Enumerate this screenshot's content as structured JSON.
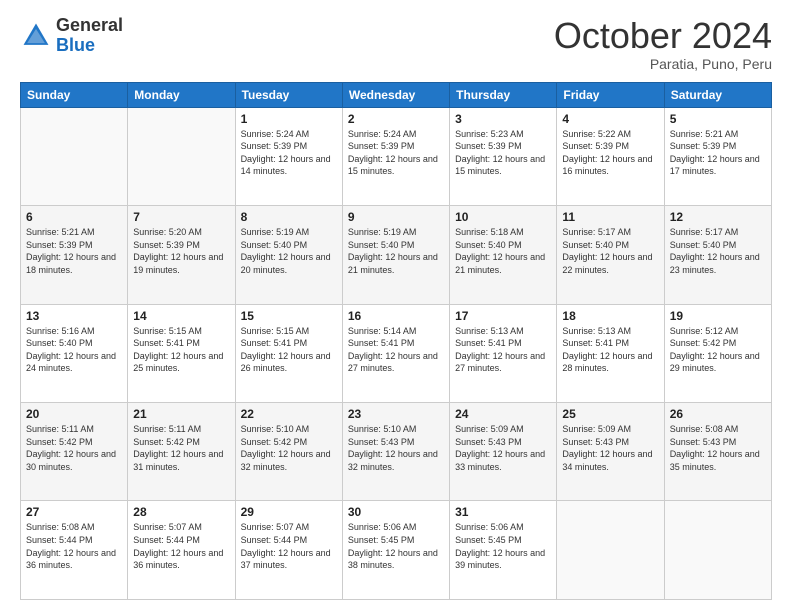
{
  "header": {
    "logo_general": "General",
    "logo_blue": "Blue",
    "month": "October 2024",
    "location": "Paratia, Puno, Peru"
  },
  "days_of_week": [
    "Sunday",
    "Monday",
    "Tuesday",
    "Wednesday",
    "Thursday",
    "Friday",
    "Saturday"
  ],
  "weeks": [
    {
      "days": [
        {
          "num": "",
          "info": ""
        },
        {
          "num": "",
          "info": ""
        },
        {
          "num": "1",
          "info": "Sunrise: 5:24 AM\nSunset: 5:39 PM\nDaylight: 12 hours and 14 minutes."
        },
        {
          "num": "2",
          "info": "Sunrise: 5:24 AM\nSunset: 5:39 PM\nDaylight: 12 hours and 15 minutes."
        },
        {
          "num": "3",
          "info": "Sunrise: 5:23 AM\nSunset: 5:39 PM\nDaylight: 12 hours and 15 minutes."
        },
        {
          "num": "4",
          "info": "Sunrise: 5:22 AM\nSunset: 5:39 PM\nDaylight: 12 hours and 16 minutes."
        },
        {
          "num": "5",
          "info": "Sunrise: 5:21 AM\nSunset: 5:39 PM\nDaylight: 12 hours and 17 minutes."
        }
      ]
    },
    {
      "days": [
        {
          "num": "6",
          "info": "Sunrise: 5:21 AM\nSunset: 5:39 PM\nDaylight: 12 hours and 18 minutes."
        },
        {
          "num": "7",
          "info": "Sunrise: 5:20 AM\nSunset: 5:39 PM\nDaylight: 12 hours and 19 minutes."
        },
        {
          "num": "8",
          "info": "Sunrise: 5:19 AM\nSunset: 5:40 PM\nDaylight: 12 hours and 20 minutes."
        },
        {
          "num": "9",
          "info": "Sunrise: 5:19 AM\nSunset: 5:40 PM\nDaylight: 12 hours and 21 minutes."
        },
        {
          "num": "10",
          "info": "Sunrise: 5:18 AM\nSunset: 5:40 PM\nDaylight: 12 hours and 21 minutes."
        },
        {
          "num": "11",
          "info": "Sunrise: 5:17 AM\nSunset: 5:40 PM\nDaylight: 12 hours and 22 minutes."
        },
        {
          "num": "12",
          "info": "Sunrise: 5:17 AM\nSunset: 5:40 PM\nDaylight: 12 hours and 23 minutes."
        }
      ]
    },
    {
      "days": [
        {
          "num": "13",
          "info": "Sunrise: 5:16 AM\nSunset: 5:40 PM\nDaylight: 12 hours and 24 minutes."
        },
        {
          "num": "14",
          "info": "Sunrise: 5:15 AM\nSunset: 5:41 PM\nDaylight: 12 hours and 25 minutes."
        },
        {
          "num": "15",
          "info": "Sunrise: 5:15 AM\nSunset: 5:41 PM\nDaylight: 12 hours and 26 minutes."
        },
        {
          "num": "16",
          "info": "Sunrise: 5:14 AM\nSunset: 5:41 PM\nDaylight: 12 hours and 27 minutes."
        },
        {
          "num": "17",
          "info": "Sunrise: 5:13 AM\nSunset: 5:41 PM\nDaylight: 12 hours and 27 minutes."
        },
        {
          "num": "18",
          "info": "Sunrise: 5:13 AM\nSunset: 5:41 PM\nDaylight: 12 hours and 28 minutes."
        },
        {
          "num": "19",
          "info": "Sunrise: 5:12 AM\nSunset: 5:42 PM\nDaylight: 12 hours and 29 minutes."
        }
      ]
    },
    {
      "days": [
        {
          "num": "20",
          "info": "Sunrise: 5:11 AM\nSunset: 5:42 PM\nDaylight: 12 hours and 30 minutes."
        },
        {
          "num": "21",
          "info": "Sunrise: 5:11 AM\nSunset: 5:42 PM\nDaylight: 12 hours and 31 minutes."
        },
        {
          "num": "22",
          "info": "Sunrise: 5:10 AM\nSunset: 5:42 PM\nDaylight: 12 hours and 32 minutes."
        },
        {
          "num": "23",
          "info": "Sunrise: 5:10 AM\nSunset: 5:43 PM\nDaylight: 12 hours and 32 minutes."
        },
        {
          "num": "24",
          "info": "Sunrise: 5:09 AM\nSunset: 5:43 PM\nDaylight: 12 hours and 33 minutes."
        },
        {
          "num": "25",
          "info": "Sunrise: 5:09 AM\nSunset: 5:43 PM\nDaylight: 12 hours and 34 minutes."
        },
        {
          "num": "26",
          "info": "Sunrise: 5:08 AM\nSunset: 5:43 PM\nDaylight: 12 hours and 35 minutes."
        }
      ]
    },
    {
      "days": [
        {
          "num": "27",
          "info": "Sunrise: 5:08 AM\nSunset: 5:44 PM\nDaylight: 12 hours and 36 minutes."
        },
        {
          "num": "28",
          "info": "Sunrise: 5:07 AM\nSunset: 5:44 PM\nDaylight: 12 hours and 36 minutes."
        },
        {
          "num": "29",
          "info": "Sunrise: 5:07 AM\nSunset: 5:44 PM\nDaylight: 12 hours and 37 minutes."
        },
        {
          "num": "30",
          "info": "Sunrise: 5:06 AM\nSunset: 5:45 PM\nDaylight: 12 hours and 38 minutes."
        },
        {
          "num": "31",
          "info": "Sunrise: 5:06 AM\nSunset: 5:45 PM\nDaylight: 12 hours and 39 minutes."
        },
        {
          "num": "",
          "info": ""
        },
        {
          "num": "",
          "info": ""
        }
      ]
    }
  ]
}
